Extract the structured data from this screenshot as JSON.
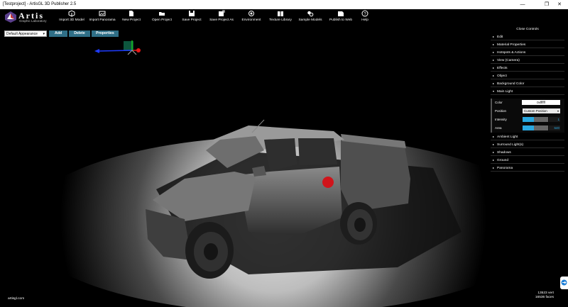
{
  "window": {
    "title": "[Testproject] - ArtisGL 3D Publisher 2.5",
    "minimize": "—",
    "restore": "❐",
    "close": "✕"
  },
  "logo": {
    "name": "Artis",
    "subtitle": "Graphic Laboratory"
  },
  "toolbar": [
    {
      "id": "import-3d-model",
      "label": "Import 3D Model",
      "icon": "import-model-icon"
    },
    {
      "id": "import-panorama",
      "label": "Import Panorama",
      "icon": "image-icon"
    },
    {
      "id": "new-project",
      "label": "New Project",
      "icon": "new-file-icon"
    },
    {
      "id": "open-project",
      "label": "Open Project",
      "icon": "folder-icon"
    },
    {
      "id": "save-project",
      "label": "Save Project",
      "icon": "save-icon"
    },
    {
      "id": "save-project-as",
      "label": "Save Project As",
      "icon": "save-as-icon"
    },
    {
      "id": "environment",
      "label": "Environment",
      "icon": "environment-icon"
    },
    {
      "id": "texture-library",
      "label": "Texture Library",
      "icon": "library-icon"
    },
    {
      "id": "sample-models",
      "label": "Sample Models",
      "icon": "models-icon"
    },
    {
      "id": "publish-to-web",
      "label": "Publish to Web",
      "icon": "publish-icon"
    },
    {
      "id": "help",
      "label": "Help",
      "icon": "help-icon"
    }
  ],
  "appearance": {
    "selected": "Default Appearance",
    "add_label": "Add",
    "delete_label": "Delete",
    "properties_label": "Properties"
  },
  "panel": {
    "close_controls": "Close Controls",
    "sections_top": [
      "Edit",
      "Material Properties",
      "Hotspots & Actions",
      "View (Camera)",
      "Effects",
      "Object",
      "Background Color",
      "Main Light"
    ],
    "main_light": {
      "color_label": "Color",
      "color_value": "0xffffff",
      "position_label": "Position",
      "position_value": "Custom Position",
      "intensity_label": "Intensity",
      "intensity_value": "1",
      "intensity_fraction": 0.45,
      "area_label": "Area",
      "area_value": "640",
      "area_fraction": 0.45
    },
    "sections_bottom": [
      "Ambient Light",
      "Surround Light(s)",
      "Shadows",
      "Ground",
      "Panorama"
    ]
  },
  "footer": {
    "site": "artisgl.com",
    "vertices": "13523 vert",
    "faces": "16536 faces"
  },
  "colors": {
    "accent": "#29a8e0",
    "button": "#2f6f87",
    "hotspot": "#d0141b"
  }
}
